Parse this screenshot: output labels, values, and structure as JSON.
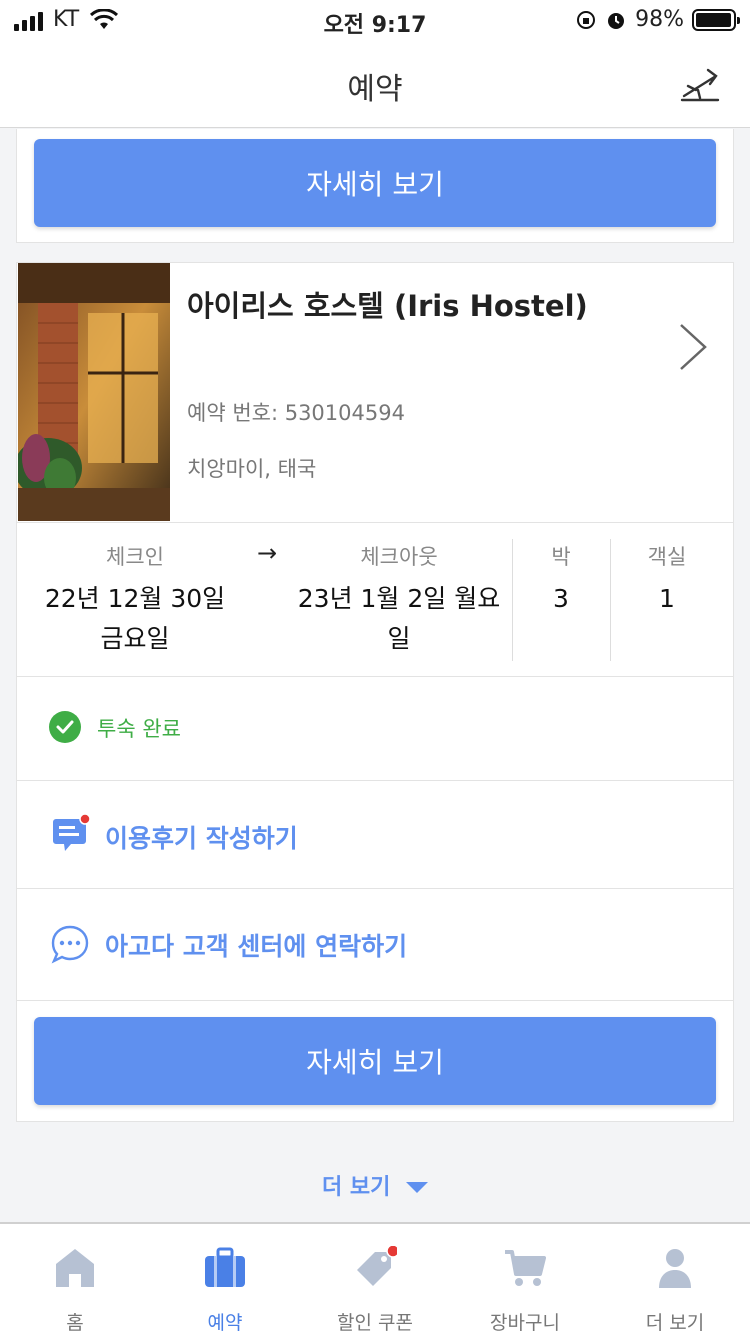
{
  "status_bar": {
    "carrier": "KT",
    "time": "오전 9:17",
    "battery": "98%",
    "battery_level": 0.98
  },
  "header": {
    "title": "예약",
    "action_icon": "airplane-icon"
  },
  "top_card": {
    "button_label": "자세히 보기"
  },
  "booking": {
    "hotel_name": "아이리스 호스텔 (Iris Hostel)",
    "booking_number": "예약 번호: 530104594",
    "location": "치앙마이, 태국",
    "checkin_label": "체크인",
    "checkin_value": "22년 12월 30일 금요일",
    "arrow": "→",
    "checkout_label": "체크아웃",
    "checkout_value": "23년 1월 2일 월요일",
    "nights_label": "박",
    "nights_value": "3",
    "rooms_label": "객실",
    "rooms_value": "1",
    "status": "투숙 완료",
    "review_action": "이용후기 작성하기",
    "contact_action": "아고다 고객 센터에 연락하기",
    "button_label": "자세히 보기"
  },
  "more": {
    "label": "더 보기"
  },
  "tabbar": {
    "items": [
      {
        "label": "홈",
        "icon": "home-icon",
        "active": false
      },
      {
        "label": "예약",
        "icon": "briefcase-icon",
        "active": true
      },
      {
        "label": "할인 쿠폰",
        "icon": "tag-icon",
        "active": false
      },
      {
        "label": "장바구니",
        "icon": "cart-icon",
        "active": false
      },
      {
        "label": "더 보기",
        "icon": "person-icon",
        "active": false
      }
    ]
  },
  "colors": {
    "accent": "#5f90ef",
    "success": "#3fad46",
    "badge": "#e53935"
  }
}
